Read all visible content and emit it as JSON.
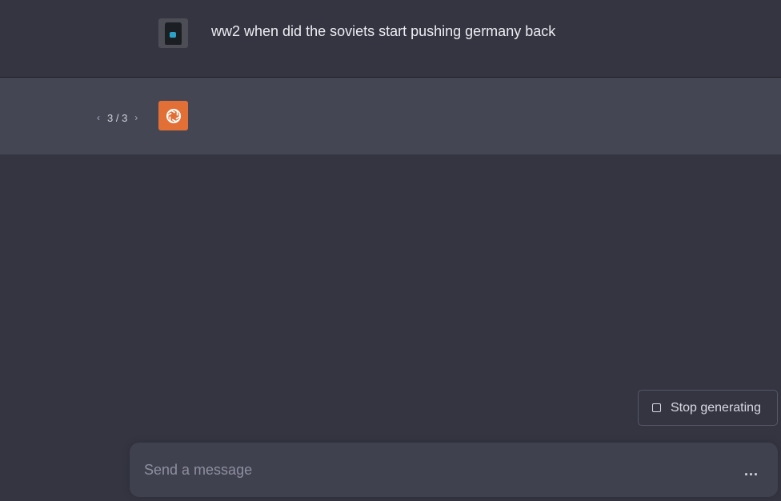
{
  "conversation": {
    "user_message": "ww2 when did the soviets start pushing germany back",
    "pager": {
      "prev_icon": "chevron-left-icon",
      "next_icon": "chevron-right-icon",
      "label": "3 / 3"
    },
    "assistant_icon": "openai-logo-icon"
  },
  "stop_button": {
    "icon": "stop-square-icon",
    "label": "Stop generating"
  },
  "composer": {
    "placeholder": "Send a message",
    "value": "",
    "loading_indicator": "..."
  },
  "colors": {
    "background": "#343541",
    "assistant_row": "#444654",
    "composer": "#40414f",
    "assistant_avatar": "#e26f36"
  }
}
